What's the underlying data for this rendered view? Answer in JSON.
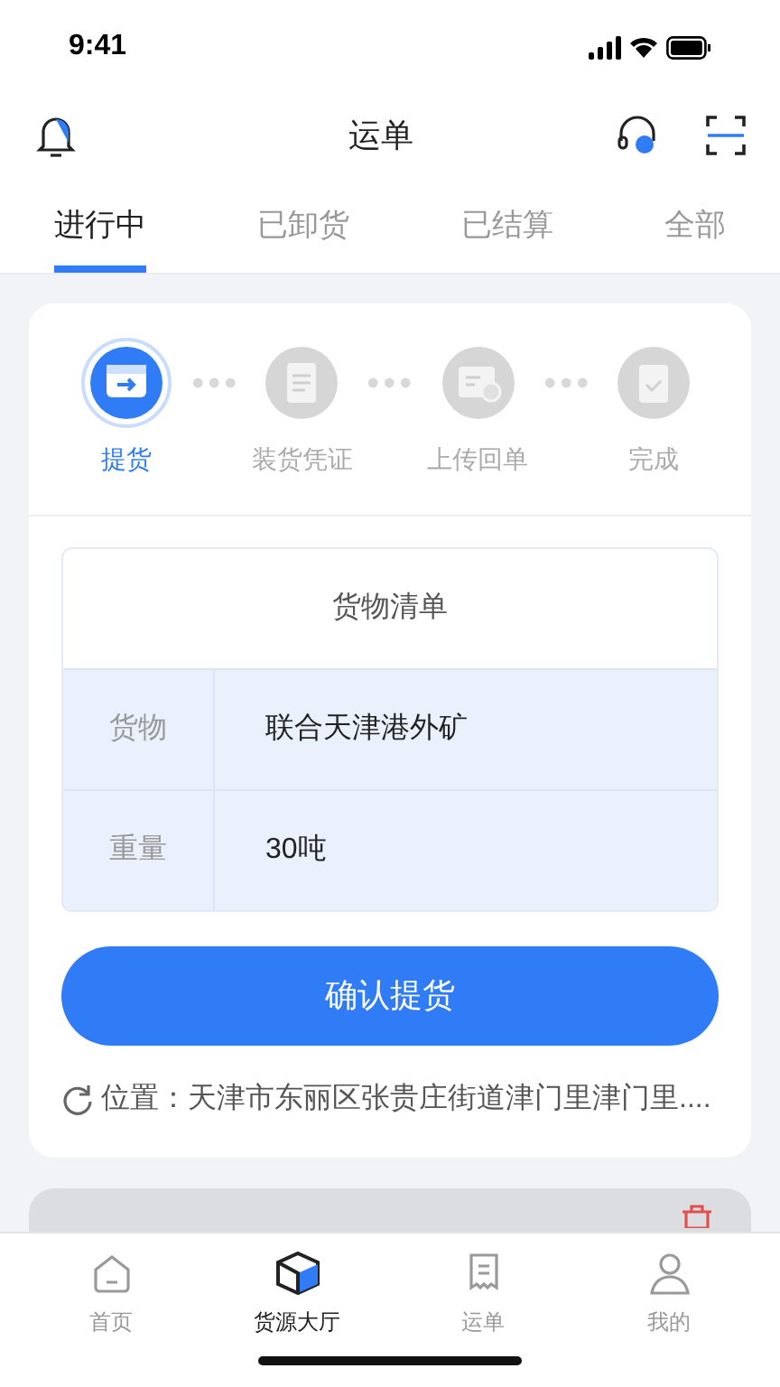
{
  "status_bar": {
    "time": "9:41"
  },
  "header": {
    "title": "运单"
  },
  "tabs": [
    {
      "label": "进行中",
      "selected": true
    },
    {
      "label": "已卸货",
      "selected": false
    },
    {
      "label": "已结算",
      "selected": false
    },
    {
      "label": "全部",
      "selected": false
    }
  ],
  "steps": [
    {
      "label": "提货",
      "kind": "pickup",
      "active": true
    },
    {
      "label": "装货凭证",
      "kind": "receipt",
      "active": false
    },
    {
      "label": "上传回单",
      "kind": "upload",
      "active": false
    },
    {
      "label": "完成",
      "kind": "done",
      "active": false
    }
  ],
  "cargo_list": {
    "title": "货物清单",
    "rows": [
      {
        "label": "货物",
        "value": "联合天津港外矿"
      },
      {
        "label": "重量",
        "value": "30吨"
      }
    ]
  },
  "confirm_button": "确认提货",
  "location": {
    "label": "位置：",
    "address": "天津市东丽区张贵庄街道津门里津门里...."
  },
  "nav": [
    {
      "label": "首页",
      "kind": "home",
      "selected": false
    },
    {
      "label": "货源大厅",
      "kind": "cargo",
      "selected": true
    },
    {
      "label": "运单",
      "kind": "orders",
      "selected": false
    },
    {
      "label": "我的",
      "kind": "me",
      "selected": false
    }
  ]
}
